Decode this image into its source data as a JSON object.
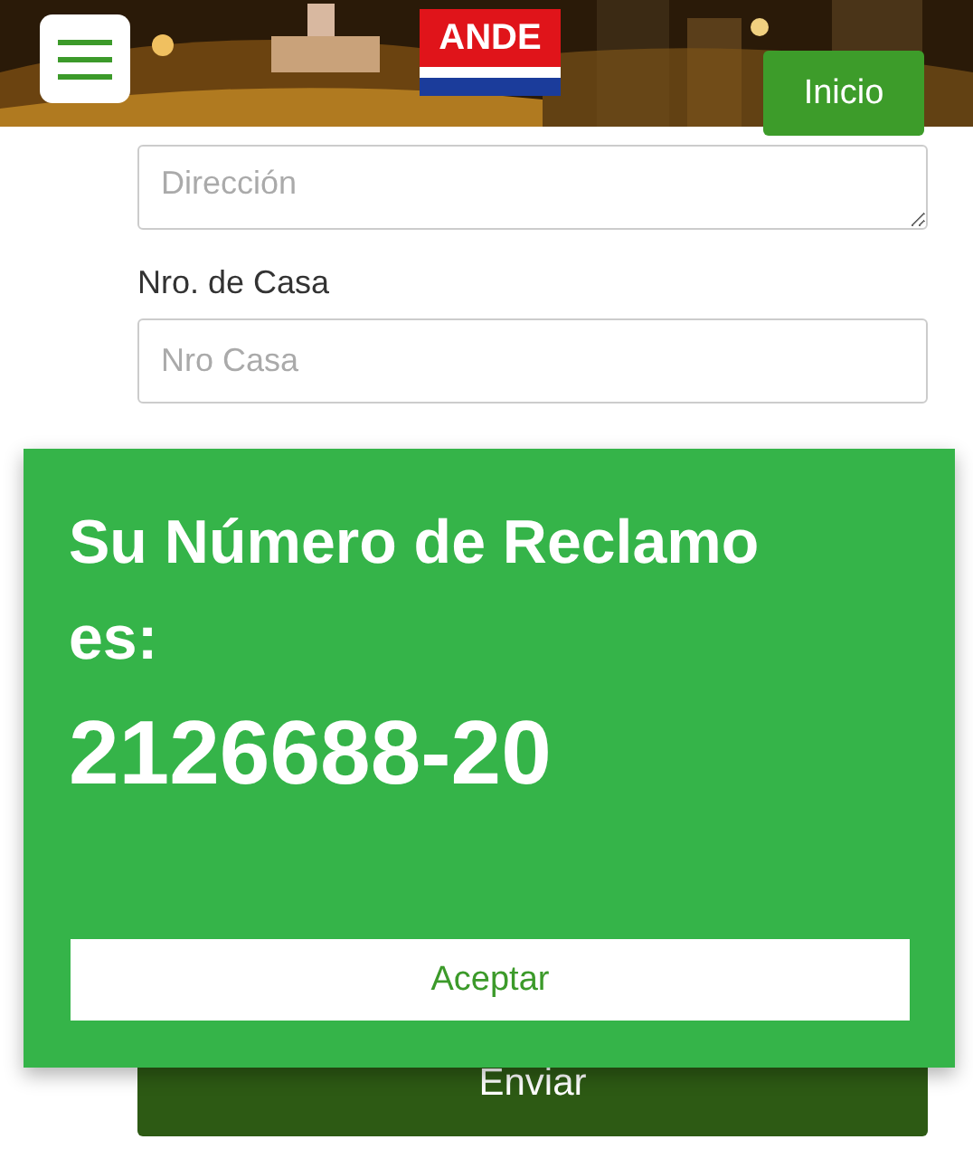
{
  "header": {
    "logo": "ANDE",
    "home_button": "Inicio"
  },
  "form": {
    "address_field": {
      "placeholder": "Dirección"
    },
    "house_number": {
      "label": "Nro. de Casa",
      "placeholder": "Nro Casa"
    },
    "submit_button": "Enviar"
  },
  "dialog": {
    "title": "Su Número de Reclamo es:",
    "claim_number": "2126688-20",
    "accept_button": "Aceptar"
  }
}
